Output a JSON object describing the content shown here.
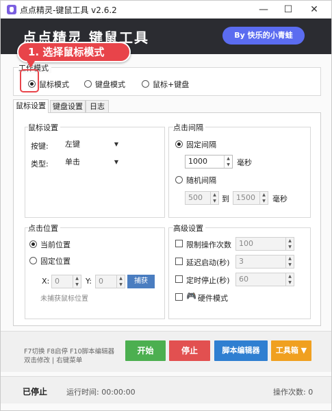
{
  "window": {
    "title": "点点精灵-键鼠工具 v2.6.2",
    "minimize_glyph": "—",
    "maximize_glyph": "☐",
    "close_glyph": "✕"
  },
  "header": {
    "title": "点点精灵 键鼠工具",
    "author_badge": "By 快乐的小青蛙"
  },
  "callout": {
    "text": "1. 选择鼠标模式",
    "color": "#e8444a"
  },
  "work_mode": {
    "label": "工作模式",
    "options": [
      "鼠标模式",
      "键盘模式",
      "鼠标+键盘"
    ],
    "selected": "鼠标模式"
  },
  "tabs": [
    "鼠标设置",
    "键盘设置",
    "日志"
  ],
  "active_tab": "鼠标设置",
  "mouse_settings": {
    "title": "鼠标设置",
    "button_label": "按键:",
    "button_value": "左键",
    "type_label": "类型:",
    "type_value": "单击"
  },
  "click_interval": {
    "title": "点击间隔",
    "fixed_label": "固定间隔",
    "fixed_value": "1000",
    "fixed_unit": "毫秒",
    "random_label": "随机间隔",
    "random_min": "500",
    "random_to": "到",
    "random_max": "1500",
    "random_unit": "毫秒"
  },
  "click_position": {
    "title": "点击位置",
    "current_label": "当前位置",
    "fixed_label": "固定位置",
    "x_label": "X:",
    "x_value": "0",
    "y_label": "Y:",
    "y_value": "0",
    "capture_label": "捕获",
    "capture_hint": "未捕获鼠标位置"
  },
  "advanced": {
    "title": "高级设置",
    "limit_label": "限制操作次数",
    "limit_value": "100",
    "delay_label": "延迟启动(秒)",
    "delay_value": "3",
    "timer_label": "定时停止(秒)",
    "timer_value": "60",
    "hardware_label": "硬件模式",
    "hardware_icon": "gamepad-icon"
  },
  "hints": {
    "line1": "F7切换 F8启停 F10脚本编辑器",
    "line2": "双击修改 | 右键菜单"
  },
  "actions": {
    "start": "开始",
    "stop": "停止",
    "script_editor": "脚本编辑器",
    "toolbox": "工具箱 ▼",
    "colors": {
      "start": "#4caf50",
      "stop": "#e25050",
      "script_editor": "#2f7fd1",
      "toolbox": "#f0a020"
    }
  },
  "status": {
    "state": "已停止",
    "runtime": "运行时间: 00:00:00",
    "op_count": "操作次数: 0"
  }
}
